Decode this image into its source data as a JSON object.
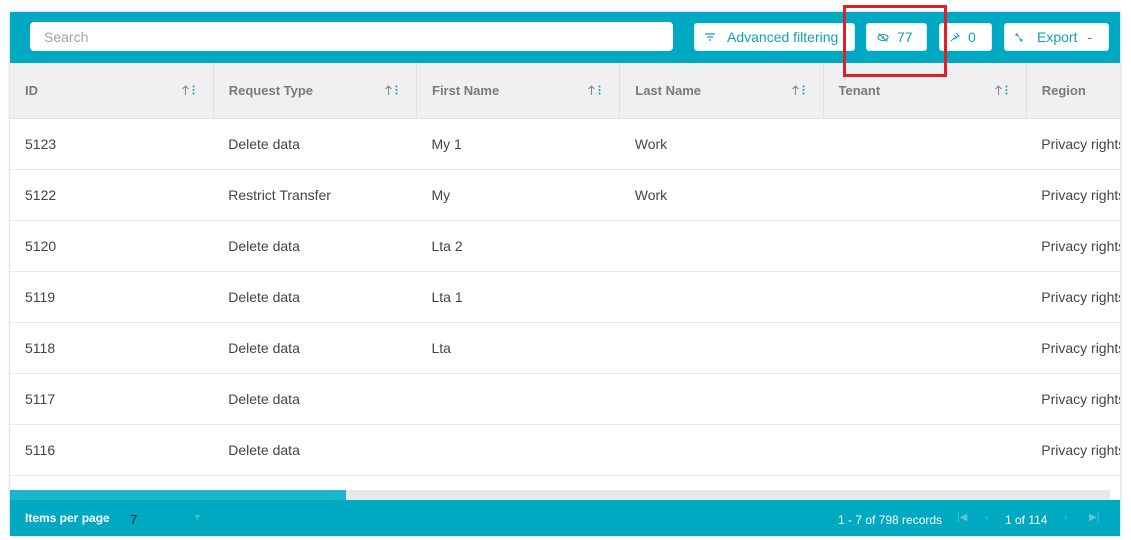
{
  "toolbar": {
    "search_placeholder": "Search",
    "advanced_filtering_label": "Advanced filtering",
    "hidden_columns_count": "77",
    "pinned_columns_count": "0",
    "export_label": "Export",
    "export_caret": "-"
  },
  "table": {
    "columns": [
      "ID",
      "Request Type",
      "First Name",
      "Last Name",
      "Tenant",
      "Region"
    ],
    "rows": [
      [
        "5123",
        "Delete data",
        "My 1",
        "Work",
        "",
        "Privacy rights r"
      ],
      [
        "5122",
        "Restrict Transfer",
        "My",
        "Work",
        "",
        "Privacy rights r"
      ],
      [
        "5120",
        "Delete data",
        "Lta 2",
        "",
        "",
        "Privacy rights r"
      ],
      [
        "5119",
        "Delete data",
        "Lta 1",
        "",
        "",
        "Privacy rights r"
      ],
      [
        "5118",
        "Delete data",
        "Lta",
        "",
        "",
        "Privacy rights r"
      ],
      [
        "5117",
        "Delete data",
        "",
        "",
        "",
        "Privacy rights r"
      ],
      [
        "5116",
        "Delete data",
        "",
        "",
        "",
        "Privacy rights r"
      ]
    ]
  },
  "footer": {
    "items_per_page_label": "Items per page",
    "items_per_page_value": "7",
    "record_range": "1 - 7 of 798 records",
    "page_label": "1 of 114"
  },
  "colors": {
    "accent": "#00a9c2",
    "highlight": "#e21e26"
  }
}
